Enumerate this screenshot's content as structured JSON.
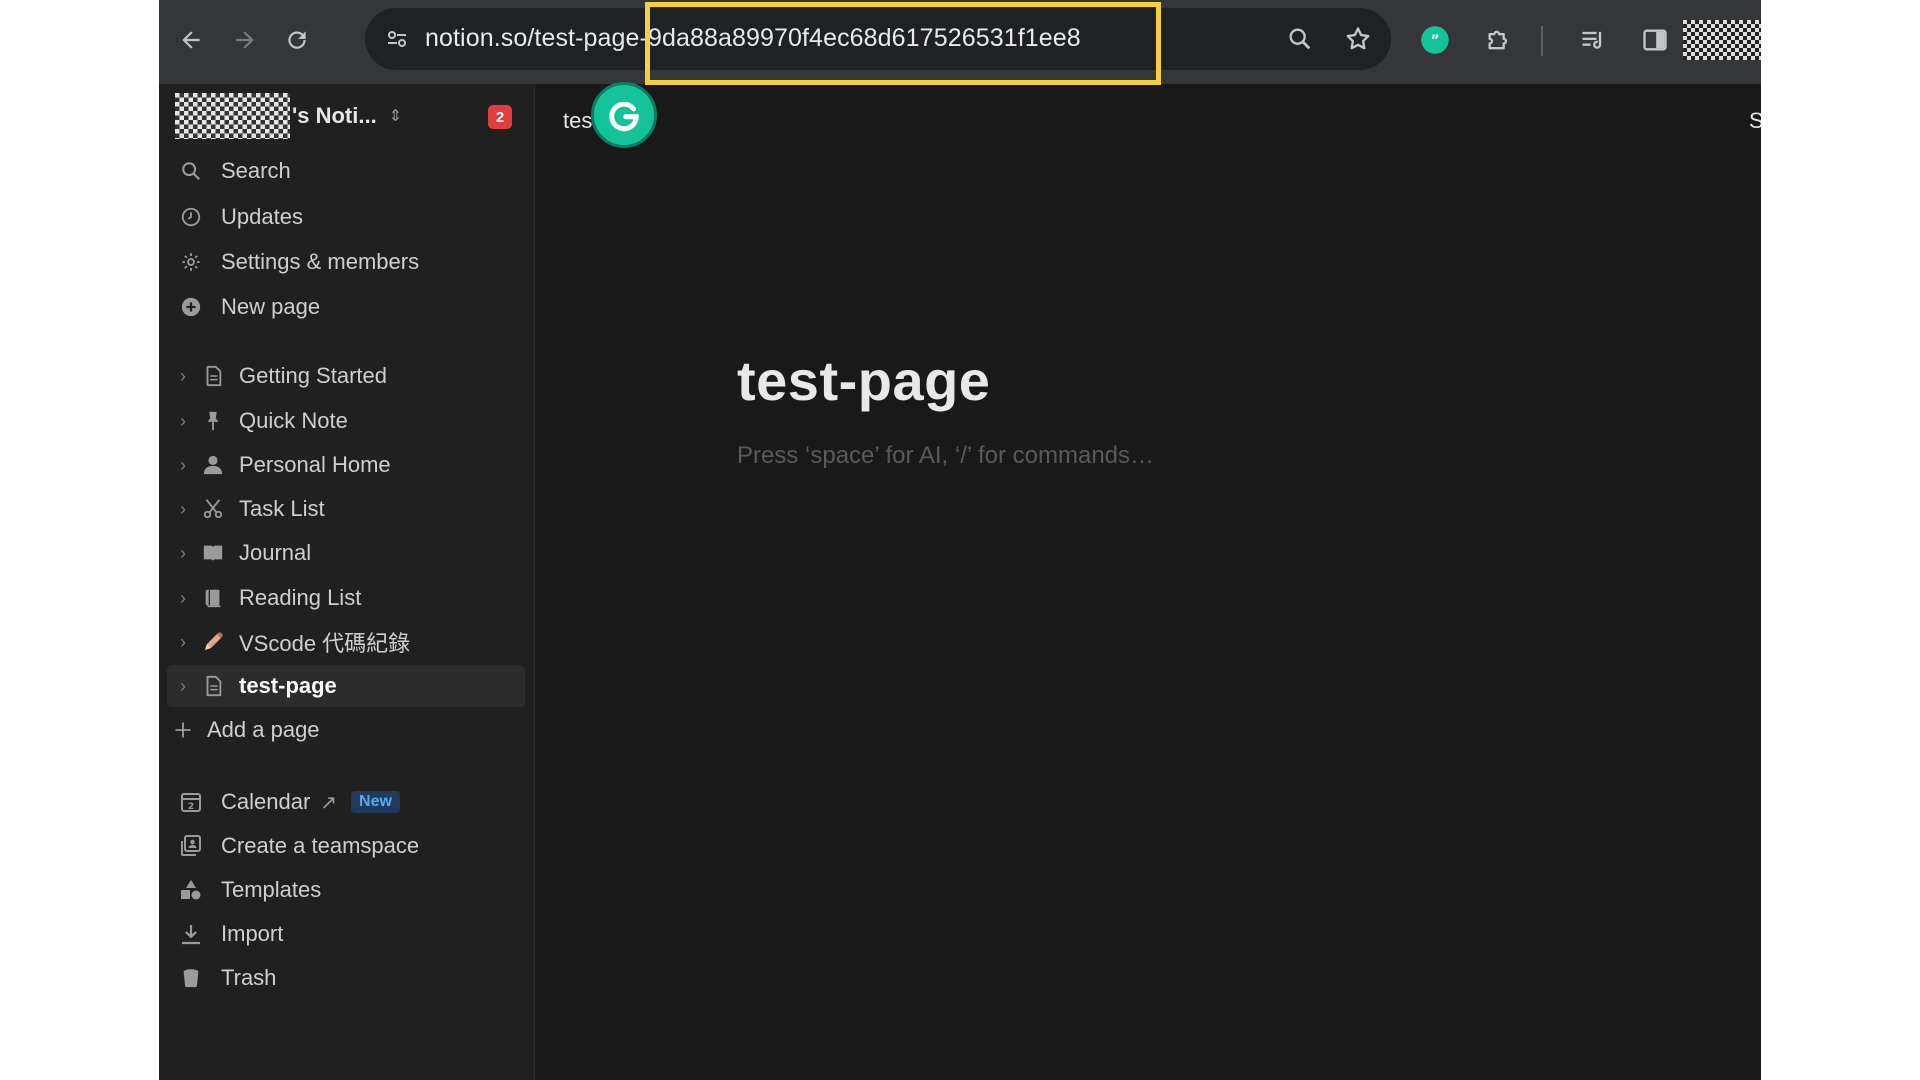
{
  "browser": {
    "url_main": "notion.so/test-page-9da88a89970f4ec68d617526531f1ee8",
    "icons": [
      "back-arrow-icon",
      "forward-arrow-icon",
      "reload-icon",
      "site-settings-icon",
      "zoom-icon",
      "bookmark-star-icon",
      "extension-icon",
      "puzzle-icon",
      "media-control-icon",
      "side-panel-icon"
    ]
  },
  "workspace": {
    "name_suffix": "'s Noti...",
    "notification_count": "2"
  },
  "sidebar": {
    "top_items": [
      {
        "label": "Search",
        "icon": "search-icon"
      },
      {
        "label": "Updates",
        "icon": "clock-icon"
      },
      {
        "label": "Settings & members",
        "icon": "gear-icon"
      },
      {
        "label": "New page",
        "icon": "plus-circle-icon"
      }
    ],
    "pages": [
      {
        "label": "Getting Started",
        "icon": "document-icon"
      },
      {
        "label": "Quick Note",
        "icon": "pin-icon"
      },
      {
        "label": "Personal Home",
        "icon": "person-icon"
      },
      {
        "label": "Task List",
        "icon": "scissors-icon"
      },
      {
        "label": "Journal",
        "icon": "book-icon"
      },
      {
        "label": "Reading List",
        "icon": "books-icon"
      },
      {
        "label": "VScode 代碼紀錄",
        "icon": "pencil-icon"
      },
      {
        "label": "test-page",
        "icon": "document-icon"
      }
    ],
    "add_page": "Add a page",
    "bottom_items": [
      {
        "label": "Calendar",
        "icon": "calendar-icon",
        "tag": "New"
      },
      {
        "label": "Create a teamspace",
        "icon": "teamspace-icon"
      },
      {
        "label": "Templates",
        "icon": "templates-icon"
      },
      {
        "label": "Import",
        "icon": "import-icon"
      },
      {
        "label": "Trash",
        "icon": "trash-icon"
      }
    ]
  },
  "main": {
    "breadcrumb": "tes",
    "share_partial": "S",
    "title": "test-page",
    "placeholder": "Press ‘space’ for AI, ‘/’ for commands…"
  },
  "colors": {
    "highlight": "#f4d03f",
    "notion_bg": "#191919",
    "sidebar_bg": "#202020",
    "chrome_bg": "#35363a",
    "badge": "#e03e3e"
  }
}
